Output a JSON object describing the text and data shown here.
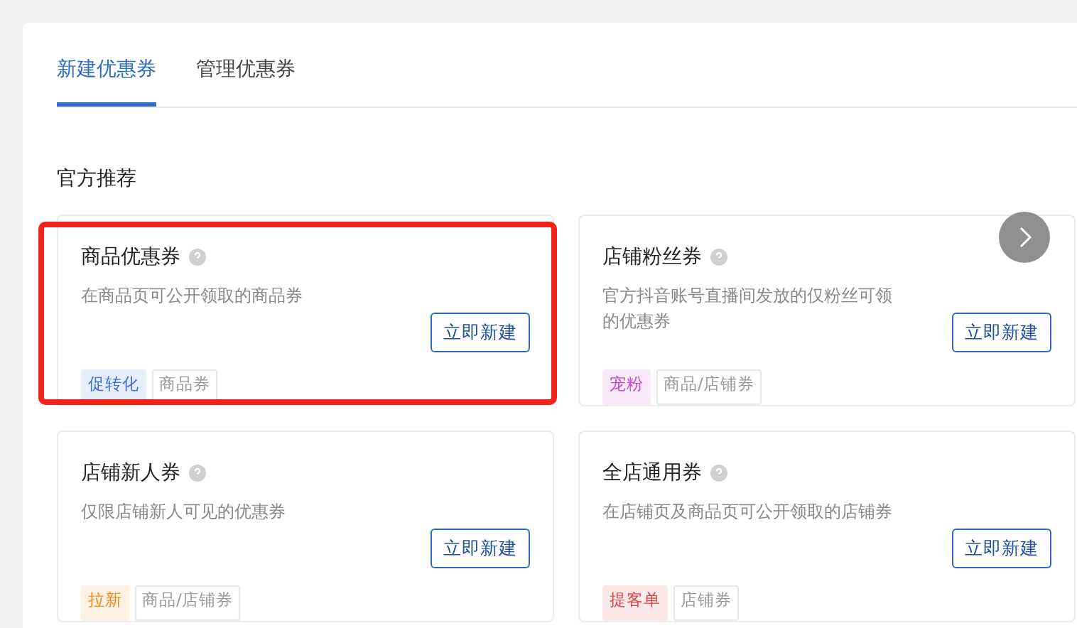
{
  "tabs": [
    {
      "label": "新建优惠券",
      "selected": true
    },
    {
      "label": "管理优惠券",
      "selected": false
    }
  ],
  "section_title": "官方推荐",
  "cards": [
    {
      "title": "商品优惠券",
      "description": "在商品页可公开领取的商品券",
      "button": "立即新建",
      "highlighted": true,
      "tags": [
        {
          "label": "促转化",
          "kind": "filled",
          "color": "#3a6fd8"
        },
        {
          "label": "商品券",
          "kind": "outline"
        }
      ]
    },
    {
      "title": "店铺粉丝券",
      "description": "官方抖音账号直播间发放的仅粉丝可领的优惠券",
      "button": "立即新建",
      "highlighted": false,
      "tags": [
        {
          "label": "宠粉",
          "kind": "filled",
          "color": "#c24ac4"
        },
        {
          "label": "商品/店铺券",
          "kind": "outline"
        }
      ]
    },
    {
      "title": "店铺新人券",
      "description": "仅限店铺新人可见的优惠券",
      "button": "立即新建",
      "highlighted": false,
      "tags": [
        {
          "label": "拉新",
          "kind": "filled",
          "color": "#f08a24"
        },
        {
          "label": "商品/店铺券",
          "kind": "outline"
        }
      ]
    },
    {
      "title": "全店通用券",
      "description": "在店铺页及商品页可公开领取的店铺券",
      "button": "立即新建",
      "highlighted": false,
      "tags": [
        {
          "label": "提客单",
          "kind": "filled",
          "color": "#e0464a"
        },
        {
          "label": "店铺券",
          "kind": "outline"
        }
      ]
    }
  ]
}
